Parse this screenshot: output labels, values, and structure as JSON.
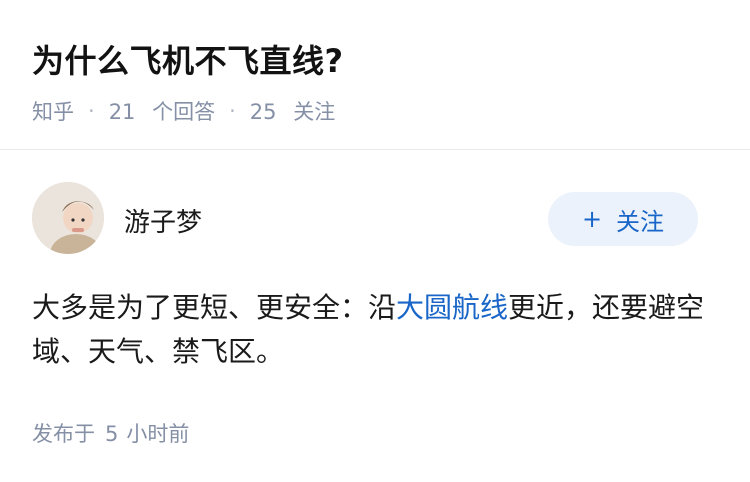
{
  "question": {
    "title": "为什么飞机不飞直线?",
    "source": "知乎",
    "answers_count": "21",
    "answers_label": "个回答",
    "followers_count": "25",
    "followers_label": "关注"
  },
  "answer": {
    "author": "游子梦",
    "follow_label": "关注",
    "content_before": "大多是为了更短、更安全：沿",
    "content_link": "大圆航线",
    "content_after": "更近，还要避空域、天气、禁飞区。",
    "published_prefix": "发布于",
    "published_num": "5",
    "published_suffix": "小时前"
  },
  "colors": {
    "accent": "#1966c8",
    "meta": "#8590a6",
    "button_bg": "#ebf2fb"
  },
  "icons": {
    "follow": "plus-icon",
    "separator": "dot-separator"
  }
}
